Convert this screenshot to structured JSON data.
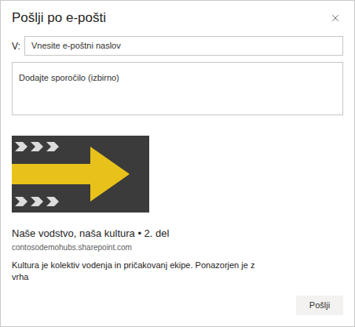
{
  "dialog": {
    "title": "Pošlji po e-pošti"
  },
  "to_field": {
    "label": "V:",
    "placeholder": "Vnesite e-poštni naslov"
  },
  "message_field": {
    "placeholder": "Dodajte sporočilo (izbirno)"
  },
  "preview": {
    "title": "Naše vodstvo, naša kultura • 2. del",
    "site": "contosodemohubs.sharepoint.com",
    "description": "Kultura je kolektiv vodenja in pričakovanj ekipe. Ponazorjen je z vrha"
  },
  "buttons": [
    "Pošlji"
  ]
}
